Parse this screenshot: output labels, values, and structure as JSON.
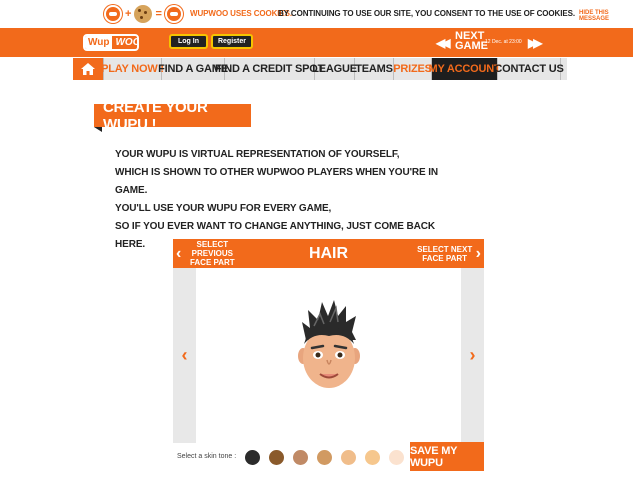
{
  "cookie_bar": {
    "title": "WUPWOO USES COOKIES.",
    "message": "BY CONTINUING TO USE OUR SITE, YOU CONSENT TO THE USE OF COOKIES.",
    "hide_label": "HIDE THIS MESSAGE",
    "plus": "+",
    "equals": "="
  },
  "header": {
    "logo_part1": "Wup",
    "logo_part2": "WOO",
    "login_label": "Log In",
    "register_label": "Register",
    "next_game_label": "NEXT GAME",
    "next_game_date": "12 Dec. at 23:00",
    "arrow_left": "◀◀",
    "arrow_right": "▶▶"
  },
  "nav": {
    "items": [
      {
        "label": "PLAY NOW !"
      },
      {
        "label": "FIND A GAME"
      },
      {
        "label": "FIND A CREDIT SPOT"
      },
      {
        "label": "LEAGUE"
      },
      {
        "label": "TEAMS"
      },
      {
        "label": "PRIZES"
      },
      {
        "label": "MY ACCOUNT"
      },
      {
        "label": "CONTACT US"
      }
    ]
  },
  "page": {
    "title": "CREATE YOUR WUPU !",
    "intro_lines": [
      "YOUR WUPU IS VIRTUAL REPRESENTATION OF YOURSELF,",
      "WHICH IS SHOWN TO OTHER WUPWOO PLAYERS WHEN YOU'RE IN GAME.",
      "YOU'LL USE YOUR WUPU FOR EVERY GAME,",
      "SO IF YOU EVER WANT TO CHANGE ANYTHING, JUST COME BACK HERE."
    ]
  },
  "editor": {
    "prev_label": "SELECT PREVIOUS FACE PART",
    "next_label": "SELECT NEXT FACE PART",
    "current_part": "HAIR",
    "left_arrow": "‹",
    "right_arrow": "›",
    "chevron_left": "‹",
    "chevron_right": "›"
  },
  "skin": {
    "label": "Select a skin tone :",
    "tones": [
      "#2b2b2b",
      "#8a5a2b",
      "#c08a66",
      "#d19a62",
      "#f0bd8a",
      "#f6c78d",
      "#fbe2cf"
    ]
  },
  "save_label": "SAVE MY WUPU",
  "colors": {
    "accent": "#f26a1b",
    "nav_bg": "#e6e6e6",
    "dark": "#1e1e1e"
  }
}
